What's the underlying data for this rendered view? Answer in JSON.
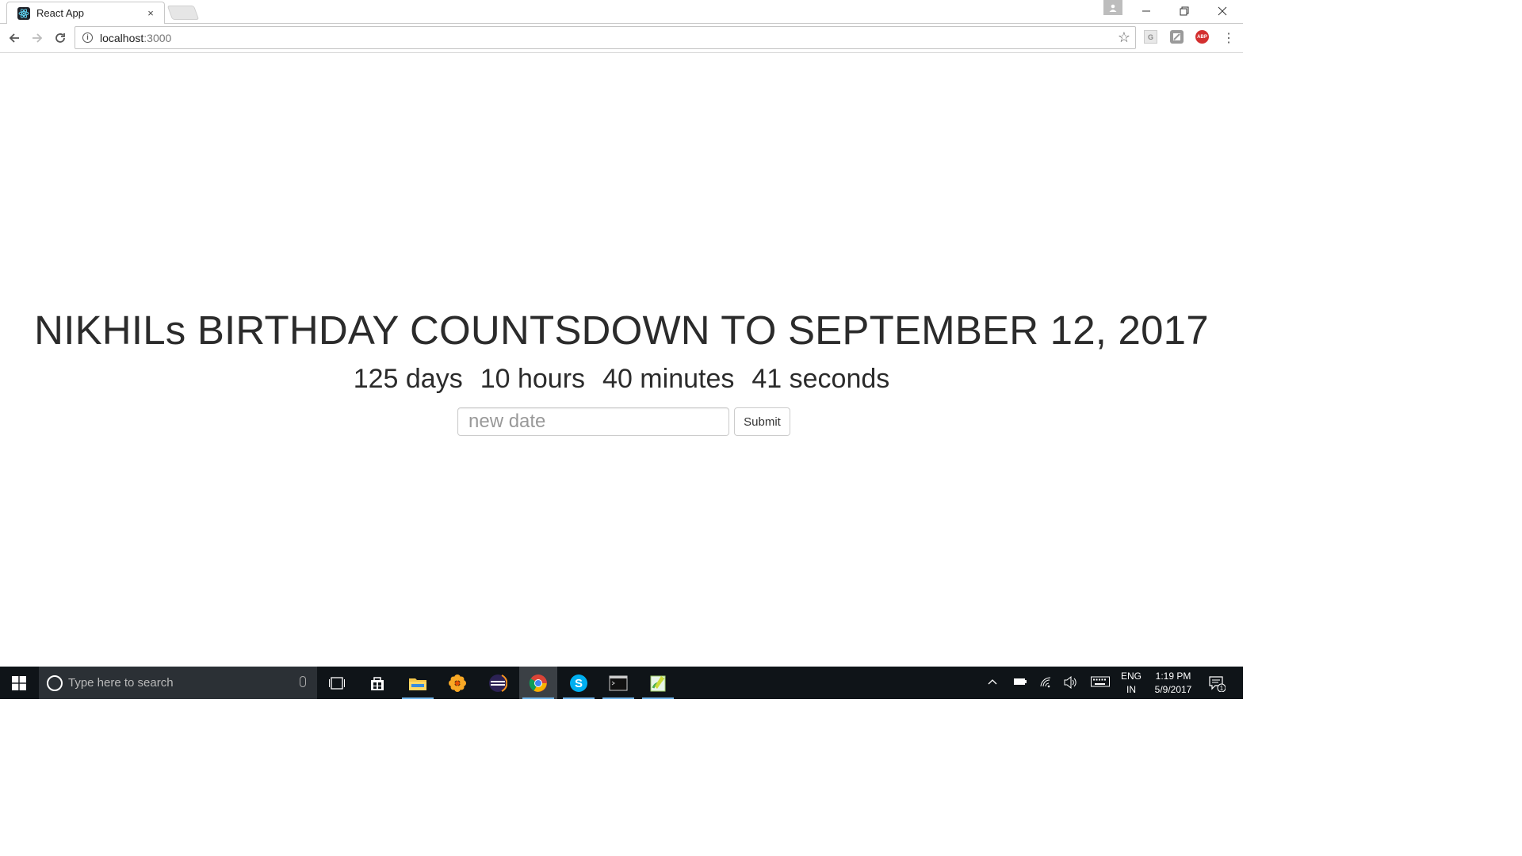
{
  "browser": {
    "tab_title": "React App",
    "tab_close": "×",
    "url_host": "localhost",
    "url_port": ":3000",
    "extensions": [
      "G",
      "",
      "ABP"
    ]
  },
  "app": {
    "heading": "NIKHILs BIRTHDAY COUNTSDOWN TO SEPTEMBER 12, 2017",
    "countdown": {
      "days": "125 days",
      "hours": "10 hours",
      "minutes": "40 minutes",
      "seconds": "41 seconds"
    },
    "date_placeholder": "new date",
    "submit_label": "Submit"
  },
  "taskbar": {
    "search_placeholder": "Type here to search",
    "lang_top": "ENG",
    "lang_bottom": "IN",
    "time": "1:19 PM",
    "date": "5/9/2017",
    "notification_count": "1"
  }
}
